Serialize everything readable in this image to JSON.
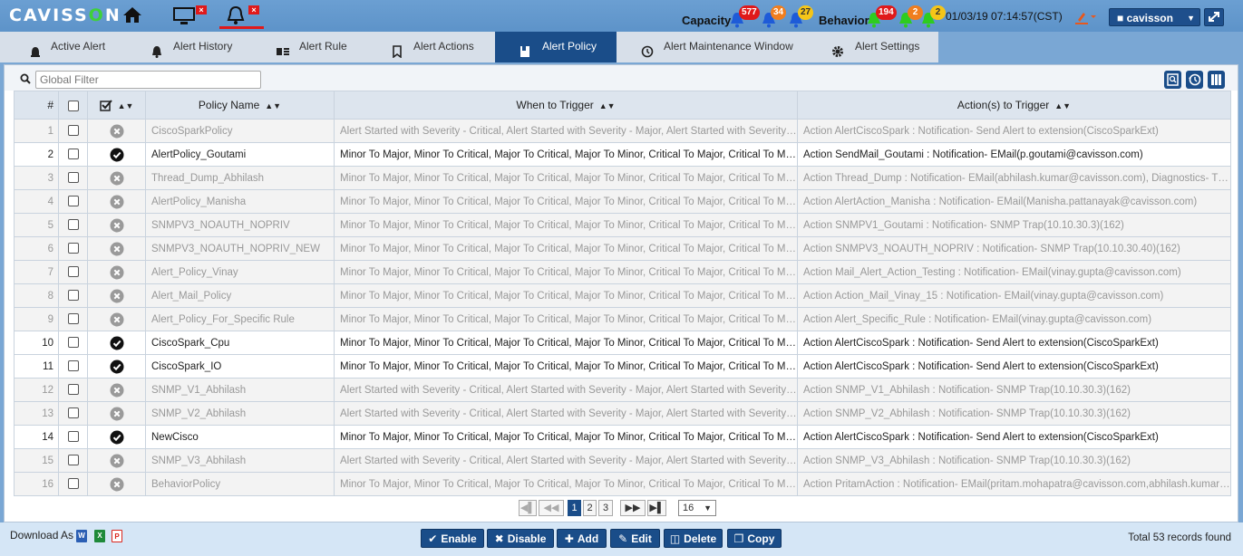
{
  "header": {
    "logo_pre": "CAVISS",
    "logo_o": "O",
    "logo_post": "N",
    "capacity_label": "Capacity",
    "capacity_counts": [
      "577",
      "34",
      "27"
    ],
    "behavior_label": "Behavior",
    "behavior_counts": [
      "194",
      "2",
      "2"
    ],
    "datetime": "01/03/19 07:14:57(CST)",
    "user": "cavisson",
    "colors": {
      "red": "#e0191a",
      "orange": "#f07e1e",
      "yellow": "#f5c518",
      "blue_bell": "#1e5bd8",
      "green_bell": "#2ecc1f"
    }
  },
  "tabs": [
    {
      "label": "Active Alert",
      "icon": "siren-icon"
    },
    {
      "label": "Alert History",
      "icon": "bell-icon"
    },
    {
      "label": "Alert Rule",
      "icon": "rule-icon"
    },
    {
      "label": "Alert Actions",
      "icon": "bookmark-icon"
    },
    {
      "label": "Alert Policy",
      "icon": "policy-icon",
      "active": true
    },
    {
      "label": "Alert Maintenance Window",
      "icon": "maintenance-icon"
    },
    {
      "label": "Alert Settings",
      "icon": "gear-icon"
    }
  ],
  "filter": {
    "placeholder": "Global Filter"
  },
  "table": {
    "columns": {
      "num": "#",
      "policy": "Policy Name",
      "when": "When to Trigger",
      "action": "Action(s) to Trigger"
    },
    "rows": [
      {
        "n": "1",
        "enabled": false,
        "name": "CiscoSparkPolicy",
        "when": "Alert Started with Severity - Critical, Alert Started with Severity - Major, Alert Started with Severity - Minor",
        "action": "Action AlertCiscoSpark : Notification- Send Alert to extension(CiscoSparkExt)"
      },
      {
        "n": "2",
        "enabled": true,
        "name": "AlertPolicy_Goutami",
        "when": "Minor To Major, Minor To Critical, Major To Critical, Major To Minor, Critical To Major, Critical To Minor",
        "action": "Action SendMail_Goutami : Notification- EMail(p.goutami@cavisson.com)"
      },
      {
        "n": "3",
        "enabled": false,
        "name": "Thread_Dump_Abhilash",
        "when": "Minor To Major, Minor To Critical, Major To Critical, Major To Minor, Critical To Major, Critical To Minor",
        "action": "Action Thread_Dump : Notification- EMail(abhilash.kumar@cavisson.com), Diagnostics- Thread Dump"
      },
      {
        "n": "4",
        "enabled": false,
        "name": "AlertPolicy_Manisha",
        "when": "Minor To Major, Minor To Critical, Major To Critical, Major To Minor, Critical To Major, Critical To Minor",
        "action": "Action AlertAction_Manisha : Notification- EMail(Manisha.pattanayak@cavisson.com)"
      },
      {
        "n": "5",
        "enabled": false,
        "name": "SNMPV3_NOAUTH_NOPRIV",
        "when": "Minor To Major, Minor To Critical, Major To Critical, Major To Minor, Critical To Major, Critical To Minor",
        "action": "Action SNMPV1_Goutami : Notification- SNMP Trap(10.10.30.3)(162)"
      },
      {
        "n": "6",
        "enabled": false,
        "name": "SNMPV3_NOAUTH_NOPRIV_NEW",
        "when": "Minor To Major, Minor To Critical, Major To Critical, Major To Minor, Critical To Major, Critical To Minor",
        "action": "Action SNMPV3_NOAUTH_NOPRIV : Notification- SNMP Trap(10.10.30.40)(162)"
      },
      {
        "n": "7",
        "enabled": false,
        "name": "Alert_Policy_Vinay",
        "when": "Minor To Major, Minor To Critical, Major To Critical, Major To Minor, Critical To Major, Critical To Minor",
        "action": "Action Mail_Alert_Action_Testing : Notification- EMail(vinay.gupta@cavisson.com)"
      },
      {
        "n": "8",
        "enabled": false,
        "name": "Alert_Mail_Policy",
        "when": "Minor To Major, Minor To Critical, Major To Critical, Major To Minor, Critical To Major, Critical To Minor",
        "action": "Action Action_Mail_Vinay_15 : Notification- EMail(vinay.gupta@cavisson.com)"
      },
      {
        "n": "9",
        "enabled": false,
        "name": "Alert_Policy_For_Specific Rule",
        "when": "Minor To Major, Minor To Critical, Major To Critical, Major To Minor, Critical To Major, Critical To Minor",
        "action": "Action Alert_Specific_Rule : Notification- EMail(vinay.gupta@cavisson.com)"
      },
      {
        "n": "10",
        "enabled": true,
        "name": "CiscoSpark_Cpu",
        "when": "Minor To Major, Minor To Critical, Major To Critical, Major To Minor, Critical To Major, Critical To Minor",
        "action": "Action AlertCiscoSpark : Notification- Send Alert to extension(CiscoSparkExt)"
      },
      {
        "n": "11",
        "enabled": true,
        "name": "CiscoSpark_IO",
        "when": "Minor To Major, Minor To Critical, Major To Critical, Major To Minor, Critical To Major, Critical To Minor",
        "action": "Action AlertCiscoSpark : Notification- Send Alert to extension(CiscoSparkExt)"
      },
      {
        "n": "12",
        "enabled": false,
        "name": "SNMP_V1_Abhilash",
        "when": "Alert Started with Severity - Critical, Alert Started with Severity - Major, Alert Started with Severity - Minor",
        "action": "Action SNMP_V1_Abhilash : Notification- SNMP Trap(10.10.30.3)(162)"
      },
      {
        "n": "13",
        "enabled": false,
        "name": "SNMP_V2_Abhilash",
        "when": "Alert Started with Severity - Critical, Alert Started with Severity - Major, Alert Started with Severity - Minor",
        "action": "Action SNMP_V2_Abhilash : Notification- SNMP Trap(10.10.30.3)(162)"
      },
      {
        "n": "14",
        "enabled": true,
        "name": "NewCisco",
        "when": "Minor To Major, Minor To Critical, Major To Critical, Major To Minor, Critical To Major, Critical To Minor",
        "action": "Action AlertCiscoSpark : Notification- Send Alert to extension(CiscoSparkExt)"
      },
      {
        "n": "15",
        "enabled": false,
        "name": "SNMP_V3_Abhilash",
        "when": "Alert Started with Severity - Critical, Alert Started with Severity - Major, Alert Started with Severity - Minor",
        "action": "Action SNMP_V3_Abhilash : Notification- SNMP Trap(10.10.30.3)(162)"
      },
      {
        "n": "16",
        "enabled": false,
        "name": "BehaviorPolicy",
        "when": "Minor To Major, Minor To Critical, Major To Critical, Major To Minor, Critical To Major, Critical To Minor",
        "action": "Action PritamAction : Notification- EMail(pritam.mohapatra@cavisson.com,abhilash.kumar@cavisson.com)"
      }
    ]
  },
  "pagination": {
    "pages": [
      "1",
      "2",
      "3"
    ],
    "current": "1",
    "page_size": "16"
  },
  "footer": {
    "download_label": "Download As :",
    "buttons": {
      "enable": "Enable",
      "disable": "Disable",
      "add": "Add",
      "edit": "Edit",
      "delete": "Delete",
      "copy": "Copy"
    },
    "total": "Total 53 records found"
  }
}
